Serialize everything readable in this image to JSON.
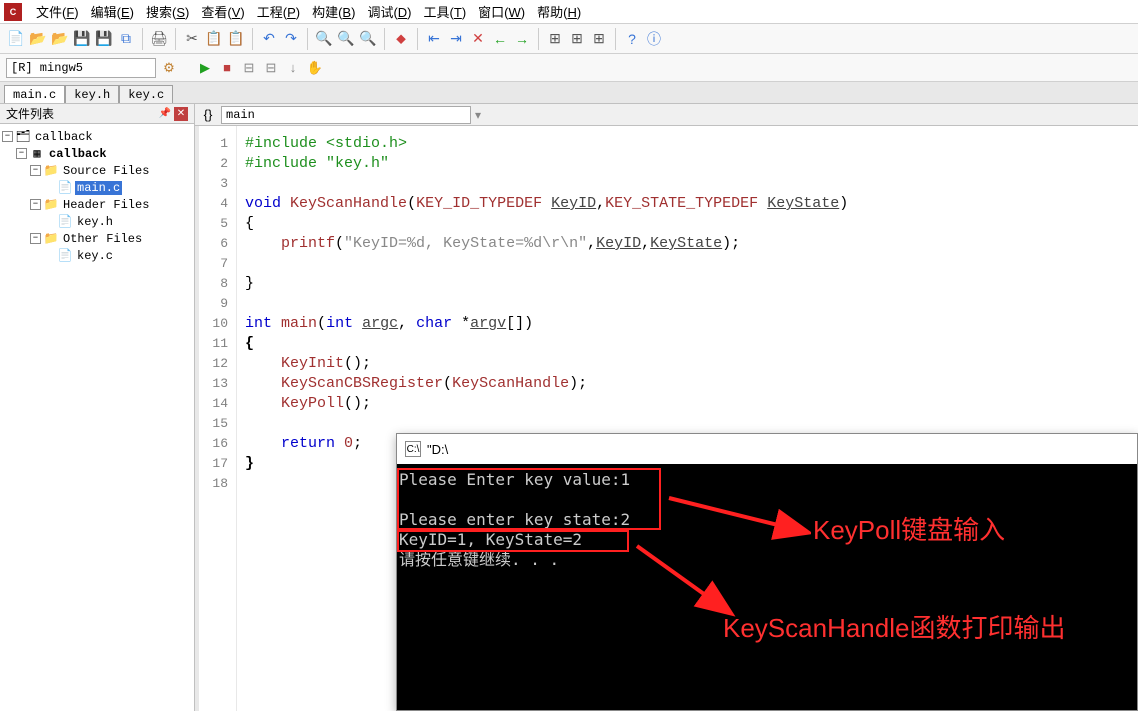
{
  "menu": {
    "items": [
      {
        "label": "文件(F)",
        "key": "F"
      },
      {
        "label": "编辑(E)",
        "key": "E"
      },
      {
        "label": "搜索(S)",
        "key": "S"
      },
      {
        "label": "查看(V)",
        "key": "V"
      },
      {
        "label": "工程(P)",
        "key": "P"
      },
      {
        "label": "构建(B)",
        "key": "B"
      },
      {
        "label": "调试(D)",
        "key": "D"
      },
      {
        "label": "工具(T)",
        "key": "T"
      },
      {
        "label": "窗口(W)",
        "key": "W"
      },
      {
        "label": "帮助(H)",
        "key": "H"
      }
    ]
  },
  "config": "[R] mingw5",
  "file_tabs": [
    "main.c",
    "key.h",
    "key.c"
  ],
  "active_tab": 0,
  "sidebar": {
    "title": "文件列表",
    "tree": {
      "root": "callback",
      "project": "callback",
      "folders": [
        {
          "name": "Source Files",
          "files": [
            "main.c"
          ],
          "selected": "main.c"
        },
        {
          "name": "Header Files",
          "files": [
            "key.h"
          ]
        },
        {
          "name": "Other Files",
          "files": [
            "key.c"
          ]
        }
      ]
    }
  },
  "symbol": "main",
  "code": {
    "lines": [
      {
        "n": 1,
        "html": "<span class='kw-pre'>#include &lt;stdio.h&gt;</span>"
      },
      {
        "n": 2,
        "html": "<span class='kw-pre'>#include \"key.h\"</span>"
      },
      {
        "n": 3,
        "html": ""
      },
      {
        "n": 4,
        "html": "<span class='kw-blue'>void</span> <span class='kw-red'>KeyScanHandle</span>(<span class='kw-red'>KEY_ID_TYPEDEF</span> <span class='param'>KeyID</span>,<span class='kw-red'>KEY_STATE_TYPEDEF</span> <span class='param'>KeyState</span>)"
      },
      {
        "n": 5,
        "html": "{"
      },
      {
        "n": 6,
        "html": "    <span class='kw-red'>printf</span>(<span class='str'>\"KeyID=%d, KeyState=%d\\r\\n\"</span>,<span class='param'>KeyID</span>,<span class='param'>KeyState</span>);"
      },
      {
        "n": 7,
        "html": ""
      },
      {
        "n": 8,
        "html": "}"
      },
      {
        "n": 9,
        "html": ""
      },
      {
        "n": 10,
        "html": "<span class='kw-blue'>int</span> <span class='kw-red'>main</span>(<span class='kw-blue'>int</span> <span class='param'>argc</span>, <span class='kw-blue'>char</span> *<span class='param'>argv</span>[])"
      },
      {
        "n": 11,
        "html": "<b>{</b>"
      },
      {
        "n": 12,
        "html": "    <span class='kw-red'>KeyInit</span>();"
      },
      {
        "n": 13,
        "html": "    <span class='kw-red'>KeyScanCBSRegister</span>(<span class='kw-red'>KeyScanHandle</span>);"
      },
      {
        "n": 14,
        "html": "    <span class='kw-red'>KeyPoll</span>();"
      },
      {
        "n": 15,
        "html": ""
      },
      {
        "n": 16,
        "html": "    <span class='kw-blue'>return</span> <span class='kw-red'>0</span>;"
      },
      {
        "n": 17,
        "html": "<b>}</b>"
      },
      {
        "n": 18,
        "html": ""
      }
    ]
  },
  "console": {
    "title": "\"D:\\",
    "lines": [
      "Please Enter key value:1",
      "",
      "Please enter key state:2",
      "KeyID=1, KeyState=2",
      "请按任意键继续. . ."
    ]
  },
  "annotations": {
    "a1": "KeyPoll键盘输入",
    "a2": "KeyScanHandle函数打印输出"
  }
}
